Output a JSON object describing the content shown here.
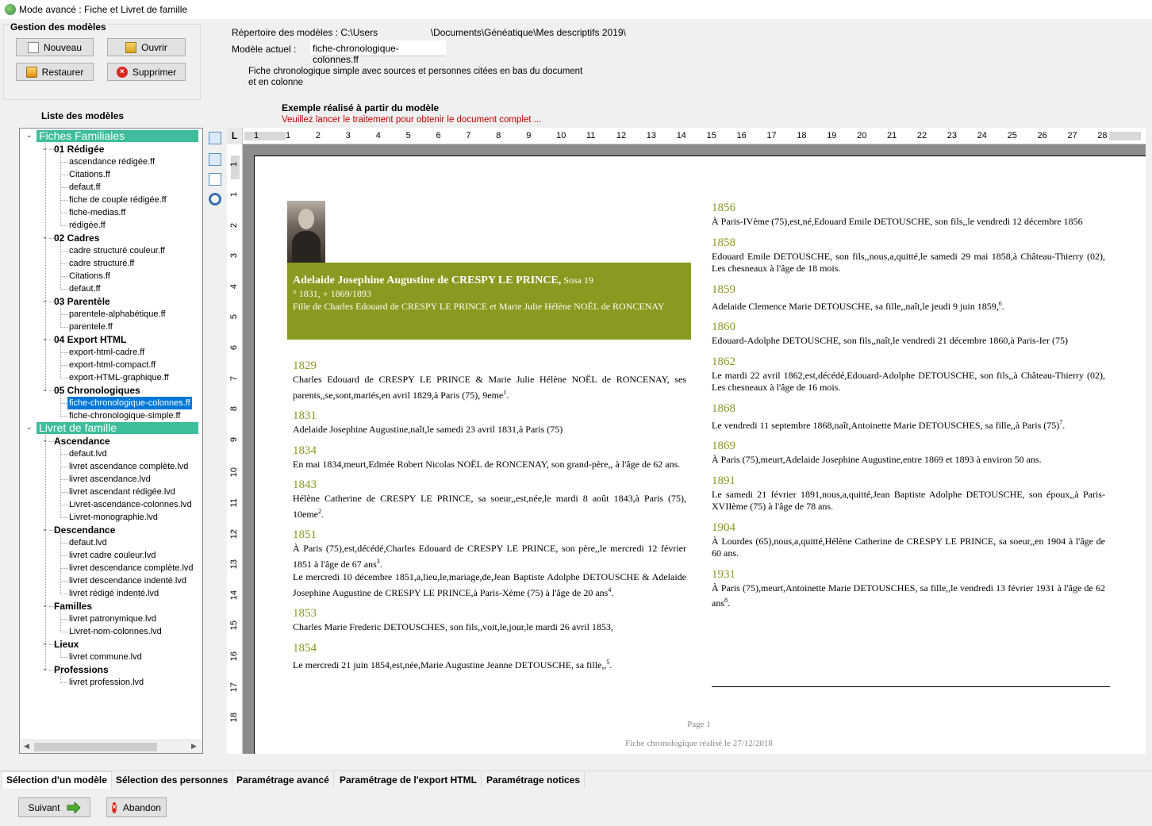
{
  "window": {
    "title": "Mode avancé : Fiche et Livret de famille"
  },
  "gestion": {
    "legend": "Gestion des modèles",
    "nouveau": "Nouveau",
    "ouvrir": "Ouvrir",
    "restaurer": "Restaurer",
    "supprimer": "Supprimer"
  },
  "liste_title": "Liste des modèles",
  "tree": {
    "root1": "Fiches Familiales",
    "g01": "01 Rédigée",
    "g01_items": [
      "ascendance rédigée.ff",
      "Citations.ff",
      "defaut.ff",
      "fiche de couple rédigée.ff",
      "fiche-medias.ff",
      "rédigée.ff"
    ],
    "g02": "02 Cadres",
    "g02_items": [
      "cadre structuré couleur.ff",
      "cadre structuré.ff",
      "Citations.ff",
      "defaut.ff"
    ],
    "g03": "03 Parentèle",
    "g03_items": [
      "parentele-alphabétique.ff",
      "parentele.ff"
    ],
    "g04": "04 Export HTML",
    "g04_items": [
      "export-html-cadre.ff",
      "export-html-compact.ff",
      "export-HTML-graphique.ff"
    ],
    "g05": "05 Chronologiques",
    "g05_items": [
      "fiche-chronologique-colonnes.ff",
      "fiche-chronologique-simple.ff"
    ],
    "root2": "Livret de famille",
    "asc": "Ascendance",
    "asc_items": [
      "defaut.lvd",
      "livret ascendance complète.lvd",
      "livret ascendance.lvd",
      "livret ascendant rédigée.lvd",
      "Livret-ascendance-colonnes.lvd",
      "Livret-monographie.lvd"
    ],
    "desc": "Descendance",
    "desc_items": [
      "defaut.lvd",
      "livret cadre couleur.lvd",
      "livret descendance complète.lvd",
      "livret descendance indenté.lvd",
      "livret rédigé indenté.lvd"
    ],
    "fam": "Familles",
    "fam_items": [
      "livret patronymique.lvd",
      "Livret-nom-colonnes.lvd"
    ],
    "lieux": "Lieux",
    "lieux_items": [
      "livret commune.lvd"
    ],
    "prof": "Professions",
    "prof_items": [
      "livret profession.lvd"
    ]
  },
  "header": {
    "repertoire": "Répertoire des modèles : C:\\Users                    \\Documents\\Généatique\\Mes descriptifs 2019\\",
    "modele_label": "Modèle actuel :",
    "modele_value": "fiche-chronologique-colonnes.ff",
    "description": "Fiche chronologique simple avec sources et personnes citées en bas du document et en colonne",
    "example_title": "Exemple réalisé à partir du modèle",
    "example_warning": "Veuillez lancer le traitement pour obtenir le document complet ..."
  },
  "ruler": {
    "corner": "L",
    "h_ticks": [
      "1",
      "1",
      "2",
      "3",
      "4",
      "5",
      "6",
      "7",
      "8",
      "9",
      "10",
      "11",
      "12",
      "13",
      "14",
      "15",
      "16",
      "17",
      "18",
      "19",
      "20",
      "21",
      "22",
      "23",
      "24",
      "25",
      "26",
      "27",
      "28"
    ],
    "v_ticks": [
      "1",
      "1",
      "2",
      "3",
      "4",
      "5",
      "6",
      "7",
      "8",
      "9",
      "10",
      "11",
      "12",
      "13",
      "14",
      "15",
      "16",
      "17",
      "18"
    ]
  },
  "document": {
    "name_bold": "Adelaide Josephine Augustine de CRESPY LE PRINCE,",
    "sosa": " Sosa 19",
    "dates": "°  1831, +  1869/1893",
    "parents": "Fille de Charles Edouard de CRESPY LE PRINCE et Marie Julie Hélène NOËL de RONCENAY",
    "left_events": [
      {
        "year": "1829",
        "text": "Charles Edouard de CRESPY LE PRINCE & Marie Julie Hélène NOËL de RONCENAY, ses parents,,se,sont,mariés,en avril 1829,à Paris (75), 9eme",
        "sup": "1",
        "end": "."
      },
      {
        "year": "1831",
        "text": "Adelaide Josephine Augustine,naît,le samedi 23 avril 1831,à Paris (75)",
        "sup": "",
        "end": ""
      },
      {
        "year": "1834",
        "text": "En mai 1834,meurt,Edmée Robert Nicolas NOËL de RONCENAY, son grand-père,, à l'âge de 62 ans.",
        "sup": "",
        "end": ""
      },
      {
        "year": "1843",
        "text": "Hélène Catherine de CRESPY LE PRINCE, sa soeur,,est,née,le mardi 8 août 1843,à Paris (75), 10eme",
        "sup": "2",
        "end": "."
      },
      {
        "year": "1851",
        "text": "À Paris (75),est,décédé,Charles Edouard de CRESPY LE PRINCE, son père,,le mercredi 12 février 1851 à l'âge de 67 ans",
        "sup": "3",
        "end": ".",
        "text2": "Le mercredi 10 décembre 1851,a,lieu,le,mariage,de,Jean Baptiste Adolphe DETOUSCHE & Adelaide Josephine Augustine de CRESPY LE PRINCE,à Paris-Xème (75) à l'âge de 20 ans",
        "sup2": "4",
        "end2": "."
      },
      {
        "year": "1853",
        "text": "Charles Marie Frederic DETOUSCHES, son fils,,voit,le,jour,le mardi 26 avril 1853,",
        "sup": "",
        "end": ""
      },
      {
        "year": "1854",
        "text": "Le mercredi 21 juin 1854,est,née,Marie Augustine Jeanne DETOUSCHE, sa fille,,",
        "sup": "5",
        "end": "."
      }
    ],
    "right_events": [
      {
        "year": "1856",
        "text": "À Paris-IVème (75),est,né,Edouard Emile DETOUSCHE, son fils,,le vendredi 12 décembre 1856",
        "sup": "",
        "end": ""
      },
      {
        "year": "1858",
        "text": "Edouard Emile DETOUSCHE, son fils,,nous,a,quitté,le samedi 29 mai 1858,à Château-Thierry (02), Les chesneaux à l'âge de 18 mois.",
        "sup": "",
        "end": ""
      },
      {
        "year": "1859",
        "text": "Adelaide Clemence Marie DETOUSCHE, sa fille,,naît,le jeudi 9 juin 1859,",
        "sup": "6",
        "end": "."
      },
      {
        "year": "1860",
        "text": "Edouard-Adolphe DETOUSCHE, son fils,,naît,le vendredi 21 décembre 1860,à Paris-Ier (75)",
        "sup": "",
        "end": ""
      },
      {
        "year": "1862",
        "text": "Le mardi 22 avril 1862,est,décédé,Edouard-Adolphe DETOUSCHE, son fils,,à Château-Thierry (02), Les chesneaux à l'âge de 16 mois.",
        "sup": "",
        "end": ""
      },
      {
        "year": "1868",
        "text": "Le vendredi 11 septembre 1868,naît,Antoinette Marie DETOUSCHES, sa fille,,à Paris (75)",
        "sup": "7",
        "end": "."
      },
      {
        "year": "1869",
        "text": "À Paris (75),meurt,Adelaide Josephine Augustine,entre 1869 et 1893 à environ 50 ans.",
        "sup": "",
        "end": ""
      },
      {
        "year": "1891",
        "text": "Le samedi 21 février 1891,nous,a,quitté,Jean Baptiste Adolphe DETOUSCHE, son époux,,à Paris-XVIIème (75) à l'âge de 78 ans.",
        "sup": "",
        "end": ""
      },
      {
        "year": "1904",
        "text": "À Lourdes (65),nous,a,quitté,Hélène Catherine de CRESPY LE PRINCE, sa soeur,,en 1904 à l'âge de 60 ans.",
        "sup": "",
        "end": ""
      },
      {
        "year": "1931",
        "text": "À Paris (75),meurt,Antoinette Marie DETOUSCHES, sa fille,,le vendredi 13 février 1931 à l'âge de 62 ans",
        "sup": "8",
        "end": "."
      }
    ],
    "page_num": "Page 1",
    "footer": "Fiche chronologique réalisé le 27/12/2018"
  },
  "tabs": [
    "Sélection d'un modèle",
    "Sélection des personnes",
    "Paramétrage avancé",
    "Paramétrage de l'export HTML",
    "Paramétrage notices"
  ],
  "bottom": {
    "suivant": "Suivant",
    "abandon": "Abandon"
  }
}
